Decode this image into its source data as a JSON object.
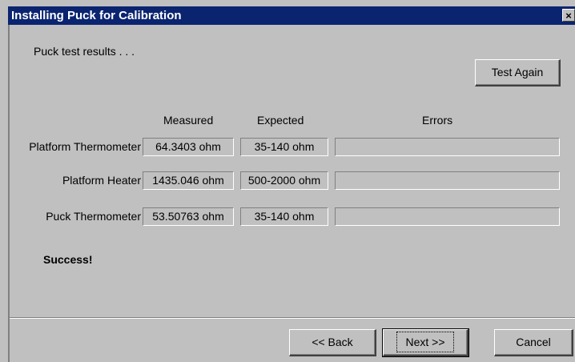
{
  "window": {
    "title": "Installing Puck for Calibration",
    "close_glyph": "×"
  },
  "intro_text": "Puck test results . . .",
  "test_again_label": "Test Again",
  "columns": {
    "measured": "Measured",
    "expected": "Expected",
    "errors": "Errors"
  },
  "rows": [
    {
      "label": "Platform Thermometer",
      "measured": "64.3403 ohm",
      "expected": "35-140 ohm",
      "errors": ""
    },
    {
      "label": "Platform Heater",
      "measured": "1435.046 ohm",
      "expected": "500-2000 ohm",
      "errors": ""
    },
    {
      "label": "Puck Thermometer",
      "measured": "53.50763 ohm",
      "expected": "35-140 ohm",
      "errors": ""
    }
  ],
  "status_text": "Success!",
  "buttons": {
    "back": "<< Back",
    "next": "Next >>",
    "cancel": "Cancel"
  },
  "colors": {
    "title_bar": "#0a2470",
    "face": "#c0c0c0"
  }
}
